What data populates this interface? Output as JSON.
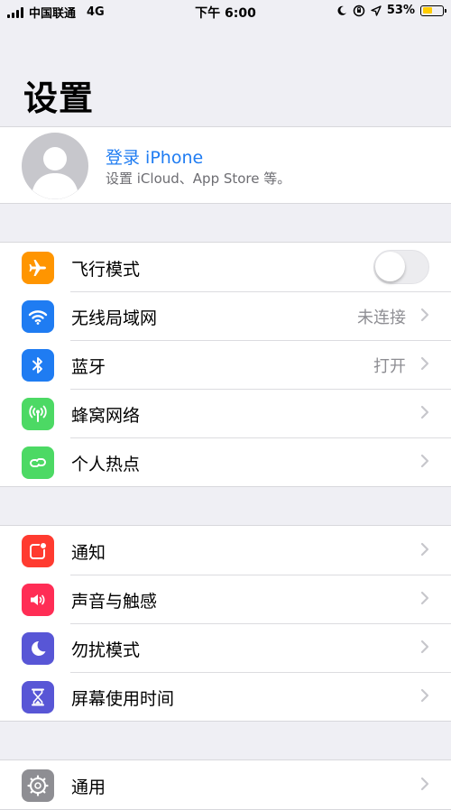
{
  "status_bar": {
    "carrier": "中国联通",
    "network": "4G",
    "time": "下午 6:00",
    "battery_percent": "53%",
    "battery_level": 0.53,
    "battery_color": "#ffcc00"
  },
  "page_title": "设置",
  "profile": {
    "title": "登录 iPhone",
    "subtitle": "设置 iCloud、App Store 等。"
  },
  "groups": [
    {
      "items": [
        {
          "label": "飞行模式",
          "icon": "airplane-icon",
          "color": "#ff9500",
          "toggle": false
        },
        {
          "label": "无线局域网",
          "icon": "wifi-icon",
          "color": "#1f7cf2",
          "value": "未连接"
        },
        {
          "label": "蓝牙",
          "icon": "bluetooth-icon",
          "color": "#1f7cf2",
          "value": "打开"
        },
        {
          "label": "蜂窝网络",
          "icon": "cellular-icon",
          "color": "#4cd964"
        },
        {
          "label": "个人热点",
          "icon": "hotspot-icon",
          "color": "#4cd964"
        }
      ]
    },
    {
      "items": [
        {
          "label": "通知",
          "icon": "notifications-icon",
          "color": "#ff3b30"
        },
        {
          "label": "声音与触感",
          "icon": "sound-icon",
          "color": "#ff2d55"
        },
        {
          "label": "勿扰模式",
          "icon": "moon-icon",
          "color": "#5856d6"
        },
        {
          "label": "屏幕使用时间",
          "icon": "hourglass-icon",
          "color": "#5856d6"
        }
      ]
    },
    {
      "items": [
        {
          "label": "通用",
          "icon": "gear-icon",
          "color": "#8e8e93"
        }
      ]
    }
  ]
}
